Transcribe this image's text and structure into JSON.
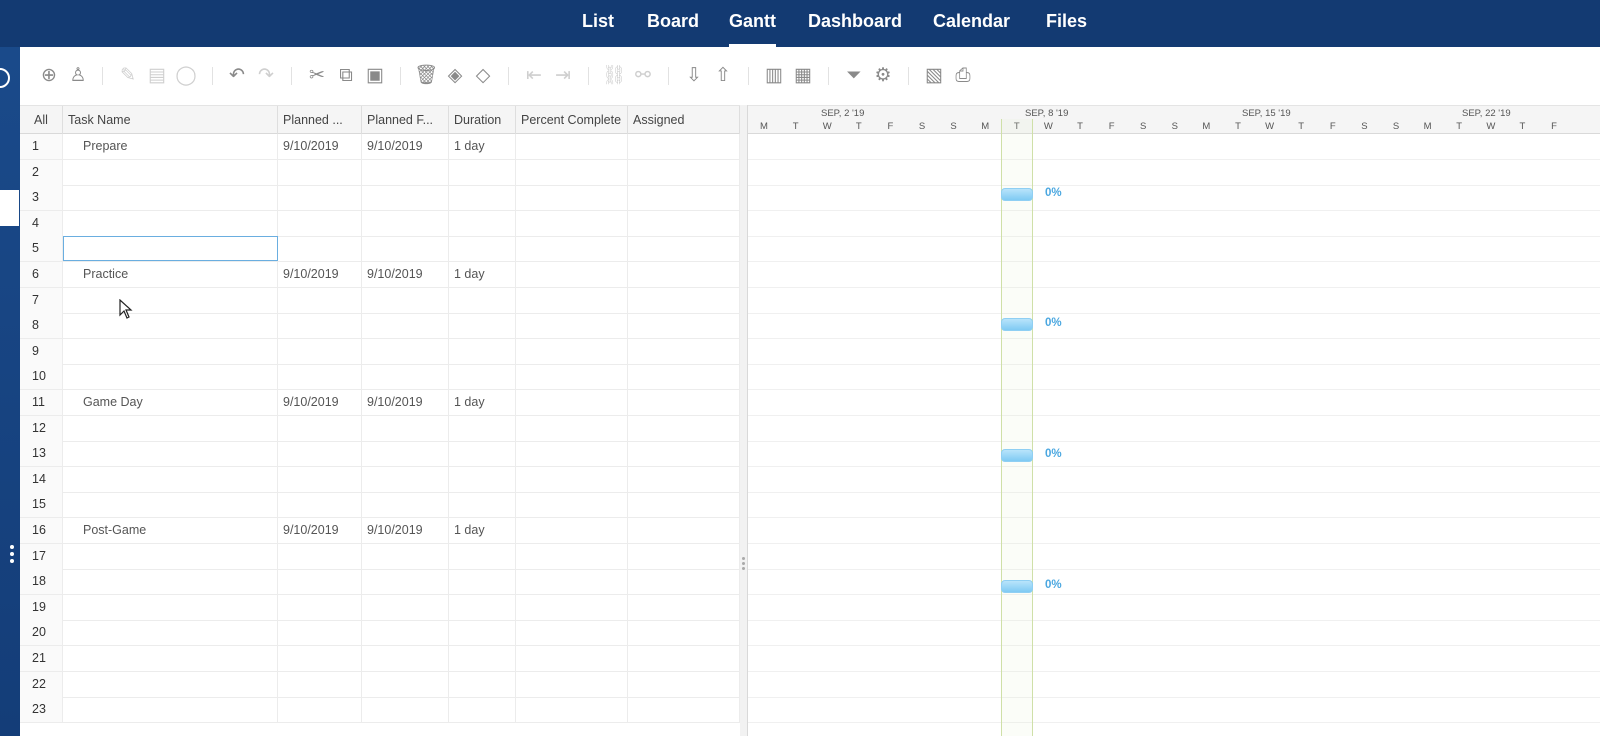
{
  "nav": {
    "tabs": [
      {
        "label": "List"
      },
      {
        "label": "Board"
      },
      {
        "label": "Gantt"
      },
      {
        "label": "Dashboard"
      },
      {
        "label": "Calendar"
      },
      {
        "label": "Files"
      }
    ],
    "active": "Gantt"
  },
  "toolbar": {
    "icons": [
      "add-task-icon",
      "assign-user-icon",
      "edit-icon",
      "notes-icon",
      "comment-icon",
      "undo-icon",
      "redo-icon",
      "cut-icon",
      "copy-icon",
      "paste-icon",
      "delete-icon",
      "fill-color-icon",
      "milestone-icon",
      "outdent-icon",
      "indent-icon",
      "link-icon",
      "unlink-icon",
      "import-icon",
      "export-icon",
      "columns-icon",
      "grid-icon",
      "filter-icon",
      "settings-icon",
      "save-icon",
      "print-icon"
    ]
  },
  "grid": {
    "columns": [
      "All",
      "Task Name",
      "Planned ...",
      "Planned F...",
      "Duration",
      "Percent Complete",
      "Assigned"
    ],
    "rows": [
      {
        "num": "1",
        "task": "Prepare",
        "start": "9/10/2019",
        "finish": "9/10/2019",
        "duration": "1 day",
        "percent": "",
        "assigned": ""
      },
      {
        "num": "2",
        "task": "",
        "start": "",
        "finish": "",
        "duration": "",
        "percent": "",
        "assigned": ""
      },
      {
        "num": "3",
        "task": "",
        "start": "",
        "finish": "",
        "duration": "",
        "percent": "",
        "assigned": ""
      },
      {
        "num": "4",
        "task": "",
        "start": "",
        "finish": "",
        "duration": "",
        "percent": "",
        "assigned": ""
      },
      {
        "num": "5",
        "task": "",
        "start": "",
        "finish": "",
        "duration": "",
        "percent": "",
        "assigned": ""
      },
      {
        "num": "6",
        "task": "Practice",
        "start": "9/10/2019",
        "finish": "9/10/2019",
        "duration": "1 day",
        "percent": "",
        "assigned": ""
      },
      {
        "num": "7",
        "task": "",
        "start": "",
        "finish": "",
        "duration": "",
        "percent": "",
        "assigned": ""
      },
      {
        "num": "8",
        "task": "",
        "start": "",
        "finish": "",
        "duration": "",
        "percent": "",
        "assigned": ""
      },
      {
        "num": "9",
        "task": "",
        "start": "",
        "finish": "",
        "duration": "",
        "percent": "",
        "assigned": ""
      },
      {
        "num": "10",
        "task": "",
        "start": "",
        "finish": "",
        "duration": "",
        "percent": "",
        "assigned": ""
      },
      {
        "num": "11",
        "task": "Game Day",
        "start": "9/10/2019",
        "finish": "9/10/2019",
        "duration": "1 day",
        "percent": "",
        "assigned": ""
      },
      {
        "num": "12",
        "task": "",
        "start": "",
        "finish": "",
        "duration": "",
        "percent": "",
        "assigned": ""
      },
      {
        "num": "13",
        "task": "",
        "start": "",
        "finish": "",
        "duration": "",
        "percent": "",
        "assigned": ""
      },
      {
        "num": "14",
        "task": "",
        "start": "",
        "finish": "",
        "duration": "",
        "percent": "",
        "assigned": ""
      },
      {
        "num": "15",
        "task": "",
        "start": "",
        "finish": "",
        "duration": "",
        "percent": "",
        "assigned": ""
      },
      {
        "num": "16",
        "task": "Post-Game",
        "start": "9/10/2019",
        "finish": "9/10/2019",
        "duration": "1 day",
        "percent": "",
        "assigned": ""
      },
      {
        "num": "17",
        "task": "",
        "start": "",
        "finish": "",
        "duration": "",
        "percent": "",
        "assigned": ""
      },
      {
        "num": "18",
        "task": "",
        "start": "",
        "finish": "",
        "duration": "",
        "percent": "",
        "assigned": ""
      },
      {
        "num": "19",
        "task": "",
        "start": "",
        "finish": "",
        "duration": "",
        "percent": "",
        "assigned": ""
      },
      {
        "num": "20",
        "task": "",
        "start": "",
        "finish": "",
        "duration": "",
        "percent": "",
        "assigned": ""
      },
      {
        "num": "21",
        "task": "",
        "start": "",
        "finish": "",
        "duration": "",
        "percent": "",
        "assigned": ""
      },
      {
        "num": "22",
        "task": "",
        "start": "",
        "finish": "",
        "duration": "",
        "percent": "",
        "assigned": ""
      },
      {
        "num": "23",
        "task": "",
        "start": "",
        "finish": "",
        "duration": "",
        "percent": "",
        "assigned": ""
      }
    ],
    "selected_row": "5"
  },
  "gantt": {
    "weeks": [
      "SEP, 2 '19",
      "SEP, 8 '19",
      "SEP, 15 '19",
      "SEP, 22 '19"
    ],
    "days": [
      "M",
      "T",
      "W",
      "T",
      "F",
      "S",
      "S",
      "M",
      "T",
      "W",
      "T",
      "F",
      "S",
      "S",
      "M",
      "T",
      "W",
      "T",
      "F",
      "S",
      "S",
      "M",
      "T",
      "W",
      "T",
      "F"
    ],
    "today": "T",
    "bars": [
      {
        "row": "1",
        "percent": "0%"
      },
      {
        "row": "6",
        "percent": "0%"
      },
      {
        "row": "11",
        "percent": "0%"
      },
      {
        "row": "16",
        "percent": "0%"
      }
    ],
    "bar_color": "#8fcff3",
    "percent_color": "#4aa7e0"
  },
  "colors": {
    "nav_bg": "#133a72",
    "accent": "#6aaee0"
  }
}
